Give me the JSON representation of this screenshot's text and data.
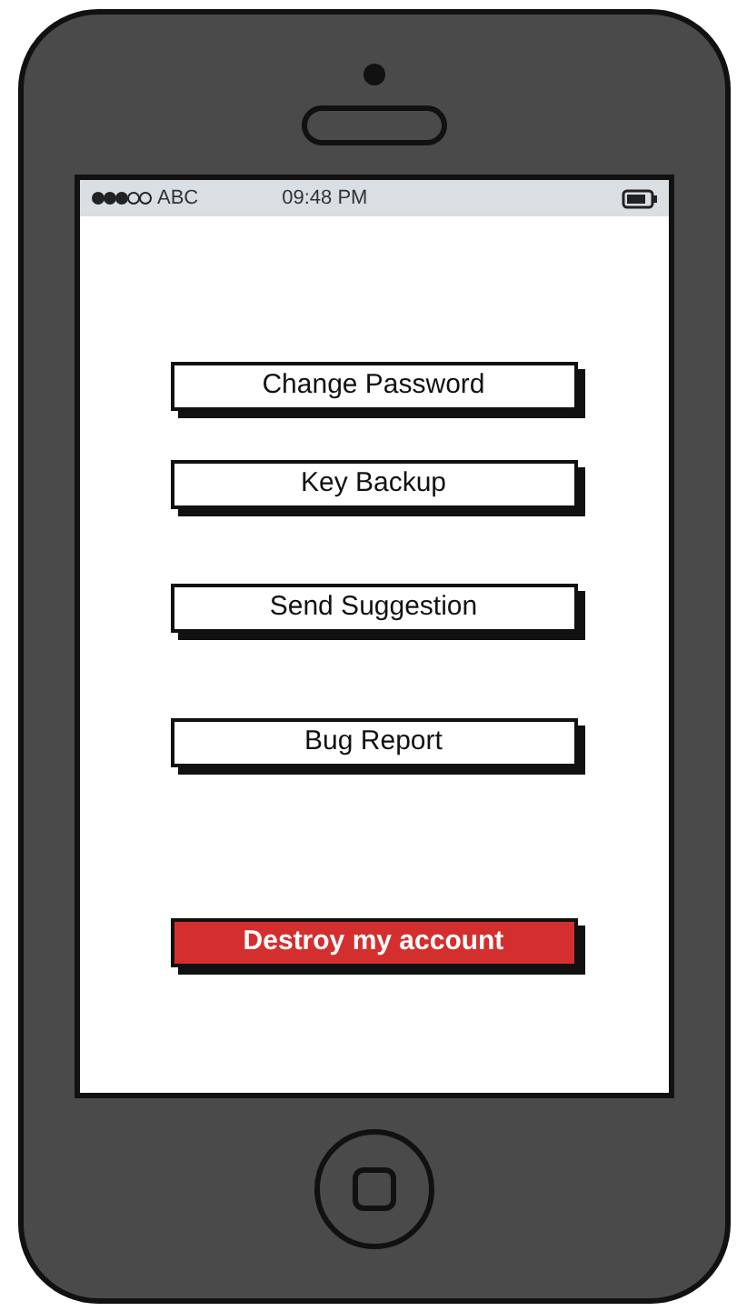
{
  "status_bar": {
    "carrier": "ABC",
    "time": "09:48 PM"
  },
  "buttons": [
    {
      "label": "Change Password",
      "kind": "default"
    },
    {
      "label": "Key Backup",
      "kind": "default"
    },
    {
      "label": "Send Suggestion",
      "kind": "default"
    },
    {
      "label": "Bug Report",
      "kind": "default"
    },
    {
      "label": "Destroy my account",
      "kind": "danger"
    }
  ]
}
